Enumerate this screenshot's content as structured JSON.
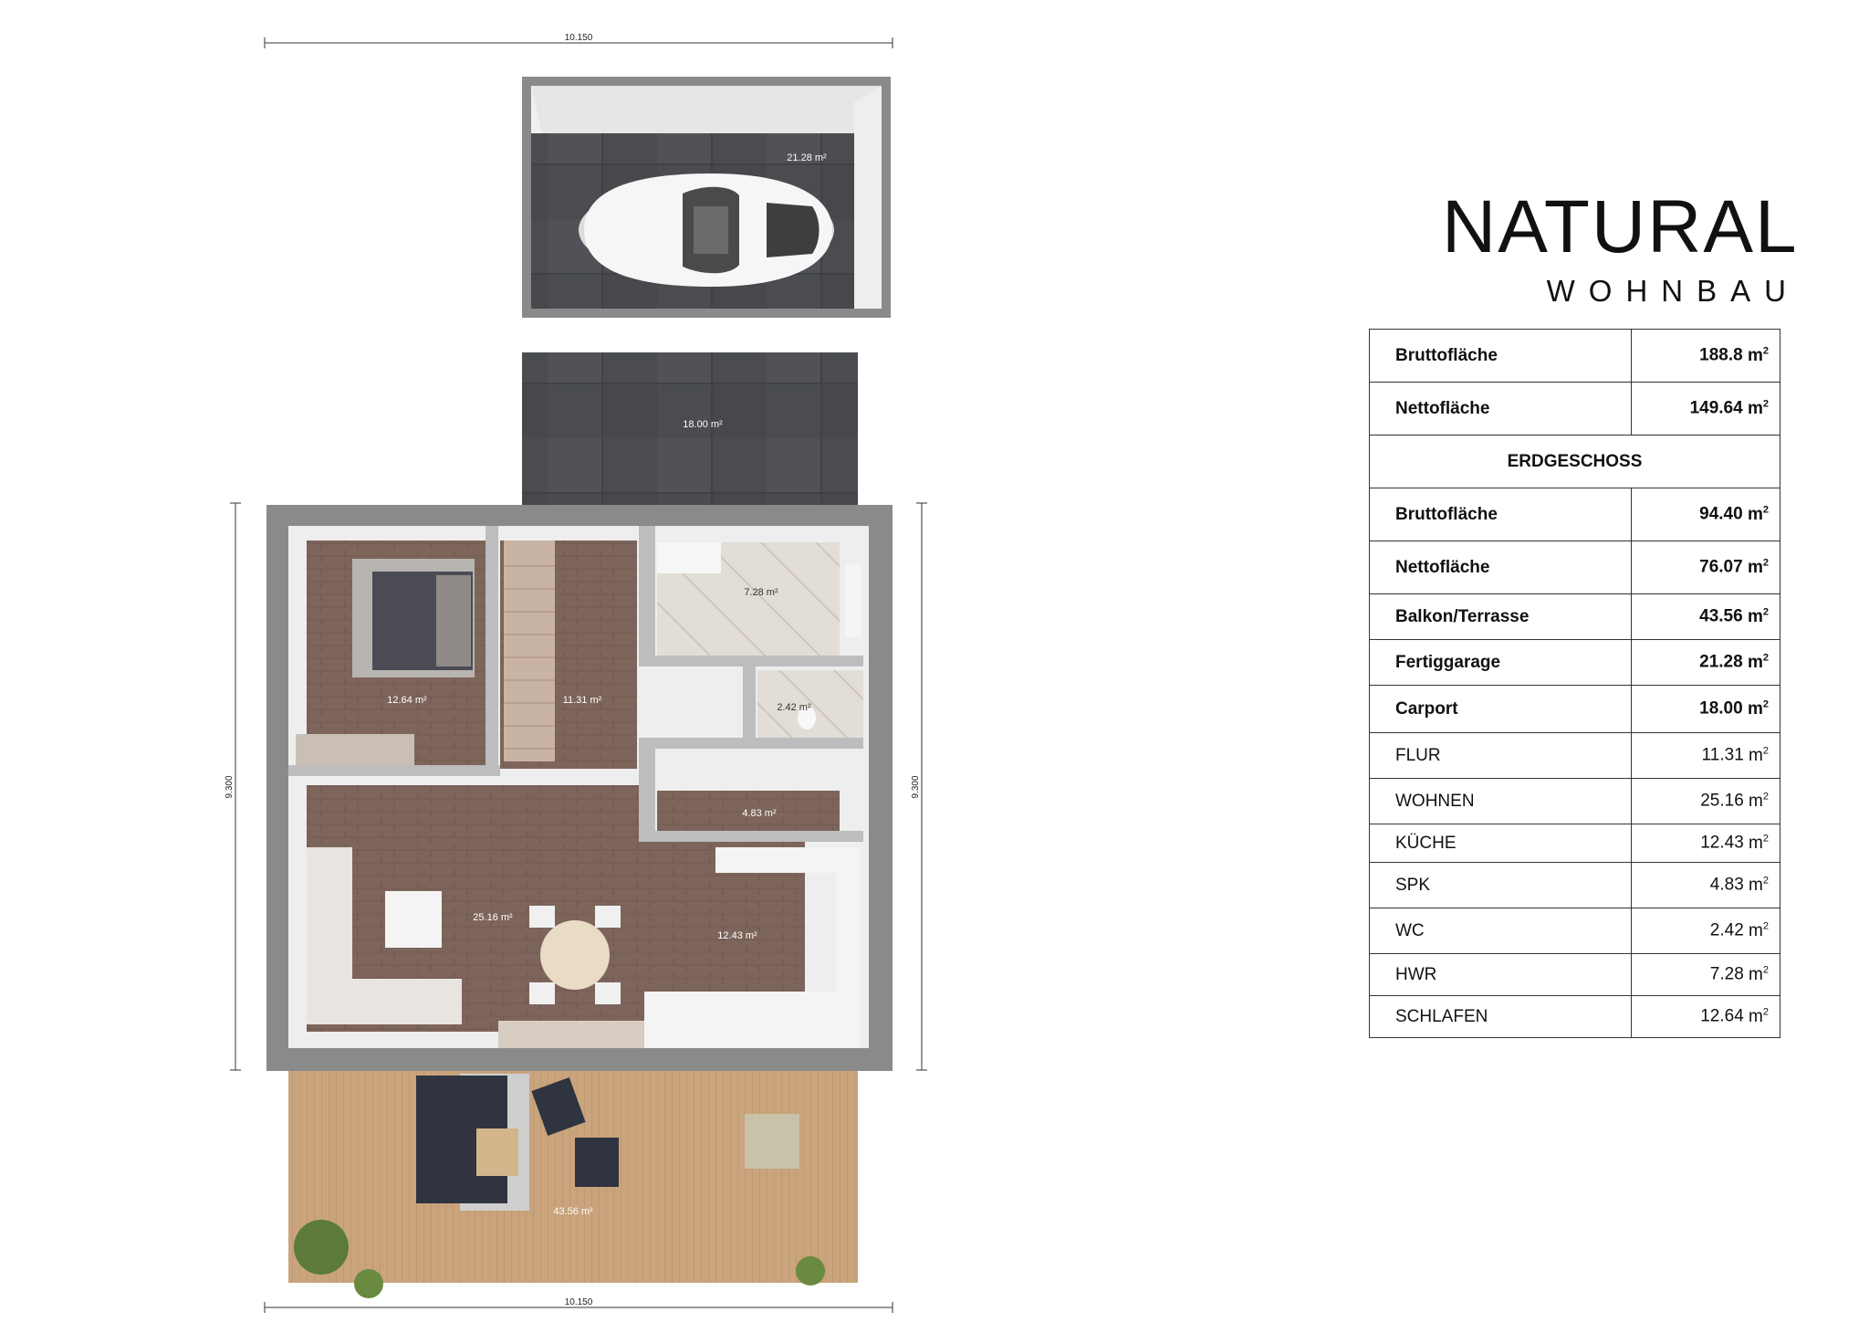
{
  "plan": {
    "dimensions": {
      "top_width": "10.150",
      "bottom_width": "10.150",
      "left_depth": "9.300",
      "right_depth": "9.300"
    },
    "room_areas": {
      "garage": "21.28 m²",
      "carport": "18.00 m²",
      "hwr": "7.28 m²",
      "wc": "2.42 m²",
      "schlafen": "12.64 m²",
      "flur": "11.31 m²",
      "spk": "4.83 m²",
      "wohnen": "25.16 m²",
      "kueche": "12.43 m²",
      "terrasse": "43.56 m²"
    }
  },
  "logo": {
    "main": "NATURAL",
    "sub": "WOHNBAU"
  },
  "area_table": {
    "section_heading": "ERDGESCHOSS",
    "unit": "m",
    "unit_exp": "2",
    "total_rows": [
      {
        "label": "Bruttofläche",
        "value": "188.8"
      },
      {
        "label": "Nettofläche",
        "value": "149.64"
      }
    ],
    "floor_rows": [
      {
        "label": "Bruttofläche",
        "value": "94.40",
        "bold": true
      },
      {
        "label": "Nettofläche",
        "value": "76.07",
        "bold": true
      },
      {
        "label": "Balkon/Terrasse",
        "value": "43.56",
        "bold": true
      },
      {
        "label": "Fertiggarage",
        "value": "21.28",
        "bold": true
      },
      {
        "label": "Carport",
        "value": "18.00",
        "bold": true
      },
      {
        "label": "FLUR",
        "value": "11.31",
        "bold": false
      },
      {
        "label": "WOHNEN",
        "value": "25.16",
        "bold": false
      },
      {
        "label": "KÜCHE",
        "value": "12.43",
        "bold": false
      },
      {
        "label": "SPK",
        "value": "4.83",
        "bold": false
      },
      {
        "label": "WC",
        "value": "2.42",
        "bold": false
      },
      {
        "label": "HWR",
        "value": "7.28",
        "bold": false
      },
      {
        "label": "SCHLAFEN",
        "value": "12.64",
        "bold": false
      }
    ]
  },
  "colors": {
    "wall": "#8a8a8a",
    "wall_inner": "#f2f2f2",
    "wood_floor": "#7e655c",
    "tile_floor": "#d9d3cc",
    "garage_floor": "#4a4c50",
    "terrace": "#c9a47c"
  }
}
